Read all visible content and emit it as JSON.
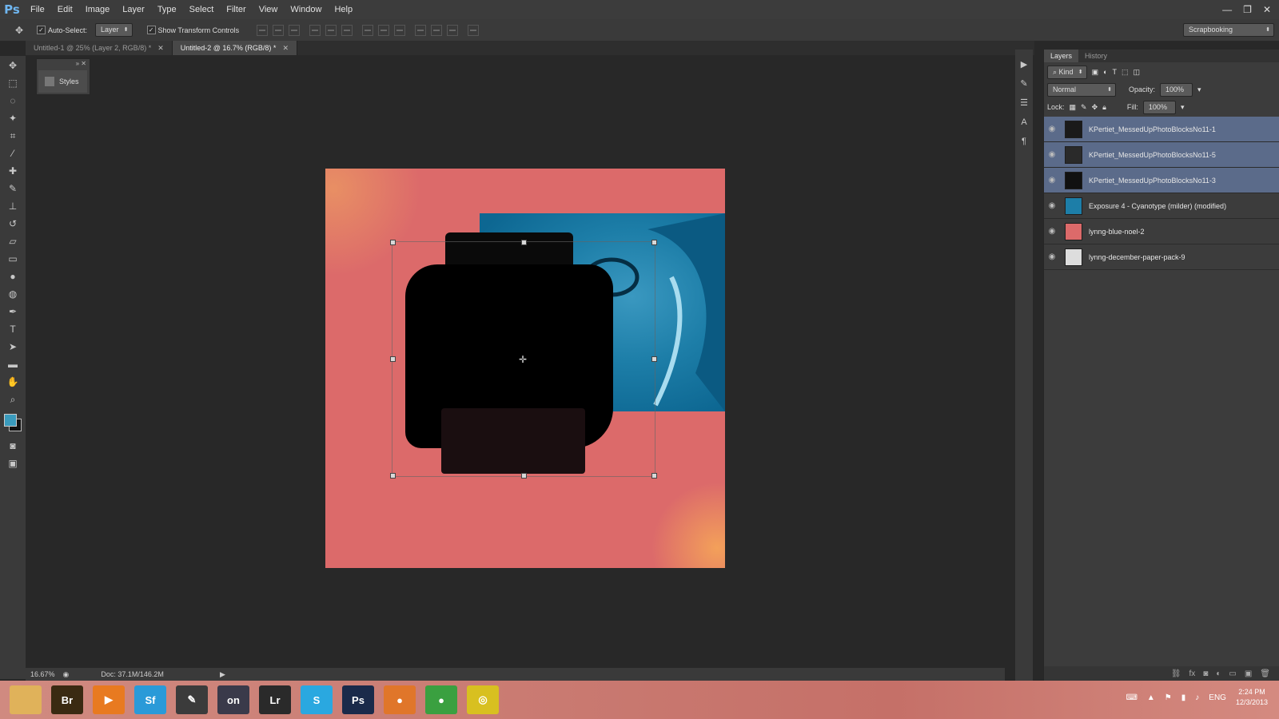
{
  "app": {
    "logo": "Ps"
  },
  "menu": [
    "File",
    "Edit",
    "Image",
    "Layer",
    "Type",
    "Select",
    "Filter",
    "View",
    "Window",
    "Help"
  ],
  "window_controls": [
    "—",
    "❐",
    "✕"
  ],
  "options_bar": {
    "auto_select_label": "Auto-Select:",
    "auto_select_value": "Layer",
    "show_transform_label": "Show Transform Controls",
    "workspace": "Scrapbooking"
  },
  "doc_tabs": [
    {
      "label": "Untitled-1 @ 25% (Layer 2, RGB/8) *",
      "active": false
    },
    {
      "label": "Untitled-2 @ 16.7% (RGB/8) *",
      "active": true
    }
  ],
  "styles_panel": {
    "label": "Styles"
  },
  "status": {
    "zoom": "16.67%",
    "doc": "Doc: 37.1M/146.2M"
  },
  "layers_panel": {
    "tabs": [
      "Layers",
      "History"
    ],
    "filter_label": "Kind",
    "blend_mode": "Normal",
    "opacity_label": "Opacity:",
    "opacity_value": "100%",
    "lock_label": "Lock:",
    "fill_label": "Fill:",
    "fill_value": "100%",
    "layers": [
      {
        "name": "KPertiet_MessedUpPhotoBlocksNo11-1",
        "selected": true,
        "thumb": "#1a1a1a"
      },
      {
        "name": "KPertiet_MessedUpPhotoBlocksNo11-5",
        "selected": true,
        "thumb": "#2a2a2a"
      },
      {
        "name": "KPertiet_MessedUpPhotoBlocksNo11-3",
        "selected": true,
        "thumb": "#111111"
      },
      {
        "name": "Exposure 4 - Cyanotype (milder) (modified)",
        "selected": false,
        "thumb": "#1d7ea8"
      },
      {
        "name": "lynng-blue-noel-2",
        "selected": false,
        "thumb": "#dc6a6a"
      },
      {
        "name": "lynng-december-paper-pack-9",
        "selected": false,
        "thumb": "#dddddd"
      }
    ]
  },
  "taskbar": {
    "apps": [
      {
        "name": "file-explorer",
        "label": "",
        "color": "#e0b25a"
      },
      {
        "name": "bridge",
        "label": "Br",
        "color": "#3a2a12"
      },
      {
        "name": "media-player",
        "label": "▶",
        "color": "#e87a20"
      },
      {
        "name": "sf-app",
        "label": "Sf",
        "color": "#2a9ad8"
      },
      {
        "name": "pen-app",
        "label": "✎",
        "color": "#3b3b3b"
      },
      {
        "name": "on-app",
        "label": "on",
        "color": "#3a3a4a"
      },
      {
        "name": "lightroom",
        "label": "Lr",
        "color": "#2a2a2a"
      },
      {
        "name": "skype",
        "label": "S",
        "color": "#2aa8e0"
      },
      {
        "name": "photoshop",
        "label": "Ps",
        "color": "#1a2a4a"
      },
      {
        "name": "firefox",
        "label": "●",
        "color": "#e0762a"
      },
      {
        "name": "chrome",
        "label": "●",
        "color": "#3aa040"
      },
      {
        "name": "other-app",
        "label": "◎",
        "color": "#d8c020"
      }
    ],
    "lang": "ENG",
    "time": "2:24 PM",
    "date": "12/3/2013"
  }
}
